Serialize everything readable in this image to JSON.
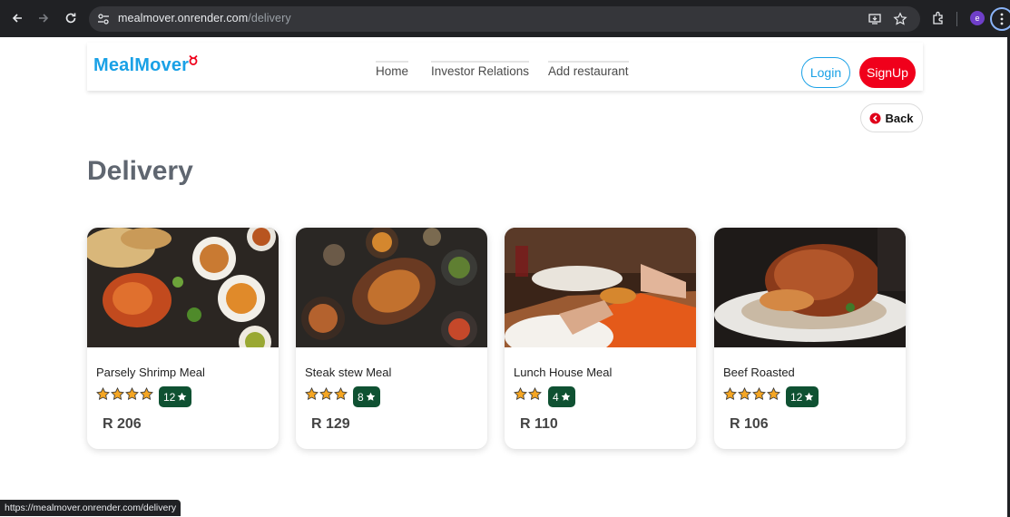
{
  "browser": {
    "url_host": "mealmover.onrender.com",
    "url_path": "/delivery",
    "profile_initial": "e",
    "status_url": "https://mealmover.onrender.com/delivery"
  },
  "navbar": {
    "logo": "MealMover",
    "links": [
      "Home",
      "Investor Relations",
      "Add restaurant"
    ],
    "login": "Login",
    "signup": "SignUp"
  },
  "back_button": "Back",
  "heading": "Delivery",
  "cards": [
    {
      "title": "Parsely Shrimp Meal",
      "rating": 4,
      "reviews": "12",
      "price": "R 206"
    },
    {
      "title": "Steak stew Meal",
      "rating": 3,
      "reviews": "8",
      "price": "R 129"
    },
    {
      "title": "Lunch House Meal",
      "rating": 2,
      "reviews": "4",
      "price": "R 110"
    },
    {
      "title": "Beef Roasted",
      "rating": 4,
      "reviews": "12",
      "price": "R 106"
    }
  ],
  "colors": {
    "brand": "#1aa1e6",
    "signup": "#f0001b",
    "badge": "#0f5132",
    "star": "#f5a623"
  }
}
